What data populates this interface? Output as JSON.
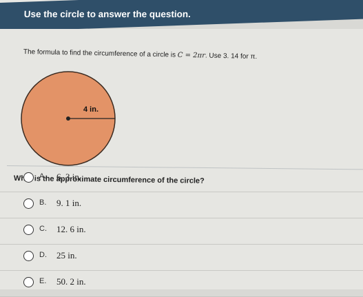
{
  "toolbar": {
    "icons": [
      "eraser-icon",
      "highlighter-icon",
      "pencil-icon",
      "cross-out-icon",
      "calculator-icon"
    ]
  },
  "banner": {
    "text": "Use the circle to answer the question."
  },
  "formula": {
    "prefix": "The formula to find the circumference of a circle is",
    "equation": "C = 2πr",
    "suffix": ". Use 3. 14 for π."
  },
  "figure": {
    "radius_label": "4 in.",
    "fill_color": "#e39367"
  },
  "question": {
    "text": "What is the approximate circumference of the circle?"
  },
  "options": [
    {
      "letter": "A.",
      "text": "6. 3 in."
    },
    {
      "letter": "B.",
      "text": "9. 1 in."
    },
    {
      "letter": "C.",
      "text": "12. 6 in."
    },
    {
      "letter": "D.",
      "text": "25 in."
    },
    {
      "letter": "E.",
      "text": "50. 2 in."
    }
  ]
}
